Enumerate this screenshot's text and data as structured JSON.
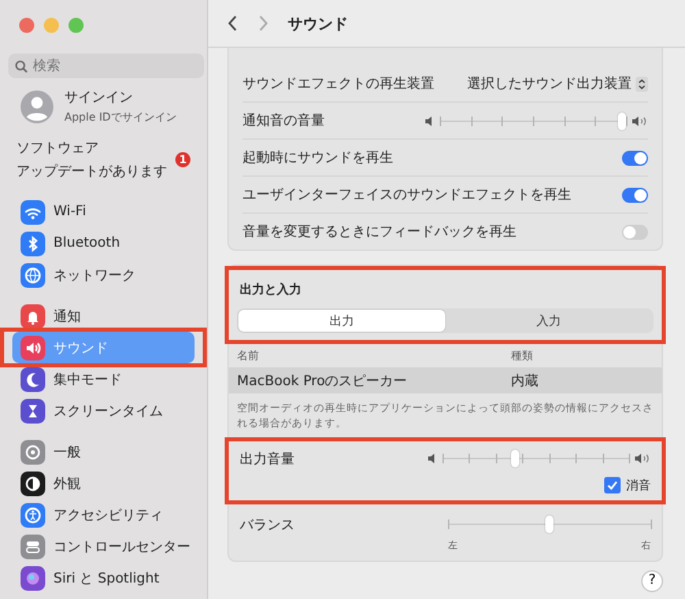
{
  "sidebar": {
    "search": {
      "placeholder": "検索"
    },
    "account": {
      "name": "サインイン",
      "subtitle": "Apple IDでサインイン"
    },
    "update": {
      "lines": [
        "ソフトウェア",
        "アップデートがあります"
      ],
      "badge": "1"
    },
    "groups": [
      {
        "items": [
          {
            "label": "Wi-Fi",
            "color": "#2f7cf6",
            "selected": false,
            "highlighted": false
          },
          {
            "label": "Bluetooth",
            "color": "#2f7cf6",
            "selected": false,
            "highlighted": false
          },
          {
            "label": "ネットワーク",
            "color": "#2f7cf6",
            "selected": false,
            "highlighted": false
          }
        ]
      },
      {
        "items": [
          {
            "label": "通知",
            "color": "#e8484a",
            "selected": false,
            "highlighted": false
          },
          {
            "label": "サウンド",
            "color": "#e8405c",
            "selected": true,
            "highlighted": true
          },
          {
            "label": "集中モード",
            "color": "#5b4fd0",
            "selected": false,
            "highlighted": false
          },
          {
            "label": "スクリーンタイム",
            "color": "#5b4fd0",
            "selected": false,
            "highlighted": false
          }
        ]
      },
      {
        "items": [
          {
            "label": "一般",
            "color": "#8e8e93",
            "selected": false,
            "highlighted": false
          },
          {
            "label": "外観",
            "color": "#1c1c1e",
            "selected": false,
            "highlighted": false
          },
          {
            "label": "アクセシビリティ",
            "color": "#2f7cf6",
            "selected": false,
            "highlighted": false
          },
          {
            "label": "コントロールセンター",
            "color": "#8e8e93",
            "selected": false,
            "highlighted": false
          },
          {
            "label": "Siri と Spotlight",
            "color": "#7a4ad0",
            "selected": false,
            "highlighted": false
          }
        ]
      }
    ]
  },
  "main": {
    "title": "サウンド",
    "effects": [
      {
        "kind": "popup",
        "label": "サウンドエフェクトの再生装置",
        "value": "選択したサウンド出力装置"
      },
      {
        "kind": "slider",
        "label": "通知音の音量",
        "level": 0.98
      },
      {
        "kind": "toggle",
        "label": "起動時にサウンドを再生",
        "on": true
      },
      {
        "kind": "toggle",
        "label": "ユーザインターフェイスのサウンドエフェクトを再生",
        "on": true
      },
      {
        "kind": "toggle",
        "label": "音量を変更するときにフィードバックを再生",
        "on": false
      }
    ],
    "output_input": {
      "title": "出力と入力",
      "highlighted": true,
      "segments": [
        {
          "label": "出力",
          "selected": true
        },
        {
          "label": "入力",
          "selected": false
        }
      ],
      "columns": [
        "名前",
        "種類"
      ],
      "rows": [
        {
          "cells": [
            "MacBook Proのスピーカー",
            "内蔵"
          ],
          "selected": true
        }
      ],
      "note": "空間オーディオの再生時にアプリケーションによって頭部の姿勢の情報にアクセスされる場合があります。"
    },
    "volume": {
      "label": "出力音量",
      "level": 0.39,
      "highlighted": true,
      "mute": {
        "label": "消音",
        "checked": true
      }
    },
    "balance": {
      "label": "バランス",
      "level": 0.5,
      "left": "左",
      "right": "右"
    },
    "help": "?"
  }
}
